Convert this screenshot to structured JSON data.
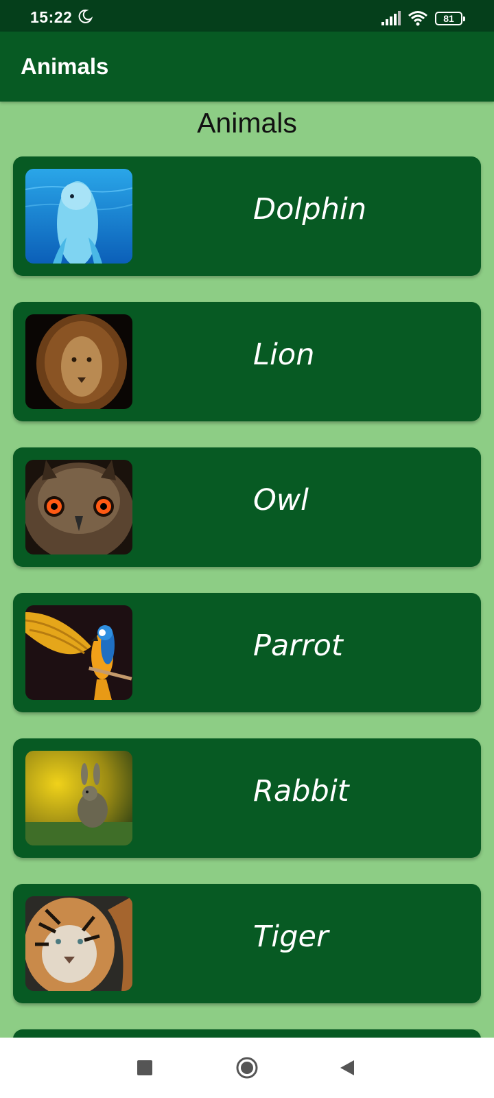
{
  "status_bar": {
    "time": "15:22",
    "battery": "81",
    "icons": [
      "moon-icon",
      "signal-icon",
      "wifi-icon",
      "battery-icon"
    ]
  },
  "app_bar": {
    "title": "Animals"
  },
  "page": {
    "heading": "Animals"
  },
  "animals": [
    {
      "name": "Dolphin",
      "image": "dolphin-photo"
    },
    {
      "name": "Lion",
      "image": "lion-photo"
    },
    {
      "name": "Owl",
      "image": "owl-photo"
    },
    {
      "name": "Parrot",
      "image": "parrot-photo"
    },
    {
      "name": "Rabbit",
      "image": "rabbit-photo"
    },
    {
      "name": "Tiger",
      "image": "tiger-photo"
    }
  ],
  "nav_bar": {
    "icons": [
      "recent-apps-icon",
      "home-icon",
      "back-icon"
    ]
  },
  "colors": {
    "status_bar": "#053f1b",
    "app_bar": "#075a23",
    "background": "#8dcd85",
    "card": "#075a23",
    "card_text": "#ffffff"
  }
}
